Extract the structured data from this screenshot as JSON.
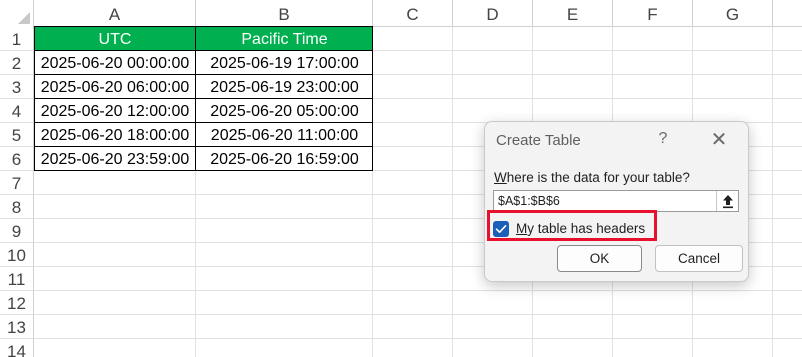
{
  "columns": [
    "A",
    "B",
    "C",
    "D",
    "E",
    "F",
    "G"
  ],
  "rows": [
    "1",
    "2",
    "3",
    "4",
    "5",
    "6",
    "7",
    "8",
    "9",
    "10",
    "11",
    "12",
    "13",
    "14"
  ],
  "table": {
    "header": [
      "UTC",
      "Pacific Time"
    ],
    "rows": [
      [
        "2025-06-20 00:00:00",
        "2025-06-19 17:00:00"
      ],
      [
        "2025-06-20 06:00:00",
        "2025-06-19 23:00:00"
      ],
      [
        "2025-06-20 12:00:00",
        "2025-06-20 05:00:00"
      ],
      [
        "2025-06-20 18:00:00",
        "2025-06-20 11:00:00"
      ],
      [
        "2025-06-20 23:59:00",
        "2025-06-20 16:59:00"
      ]
    ],
    "header_color": "#00b050"
  },
  "dialog": {
    "title": "Create Table",
    "help_glyph": "?",
    "close_glyph": "✕",
    "question_first": "W",
    "question_rest": "here is the data for your table?",
    "range_value": "$A$1:$B$6",
    "range_button_icon": "collapse-dialog-icon",
    "checkbox_checked": true,
    "checkbox_label_first": "M",
    "checkbox_label_rest": "y table has headers",
    "ok_label": "OK",
    "cancel_label": "Cancel",
    "highlight_color": "#e8112d",
    "checkbox_color": "#1b5fb8"
  }
}
